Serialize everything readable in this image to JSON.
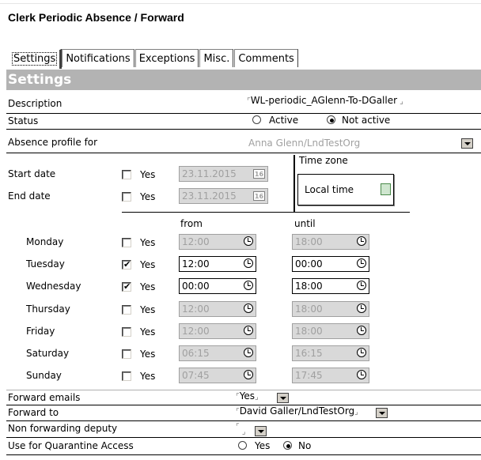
{
  "title": "Clerk Periodic Absence / Forward",
  "tabs": [
    {
      "label": "Settings",
      "active": true
    },
    {
      "label": "Notifications"
    },
    {
      "label": "Exceptions"
    },
    {
      "label": "Misc."
    },
    {
      "label": "Comments"
    }
  ],
  "section_title": "Settings",
  "description": {
    "label": "Description",
    "value": "WL-periodic_AGlenn-To-DGaller"
  },
  "status": {
    "label": "Status",
    "options": [
      "Active",
      "Not active"
    ],
    "selected": "Not active"
  },
  "absence_profile": {
    "label": "Absence profile for",
    "value": "Anna Glenn/LndTestOrg"
  },
  "start_date": {
    "label": "Start date",
    "yes_label": "Yes",
    "checked": false,
    "value": "23.11.2015",
    "cal_icon": "16"
  },
  "end_date": {
    "label": "End date",
    "yes_label": "Yes",
    "checked": false,
    "value": "23.11.2015",
    "cal_icon": "16"
  },
  "time_zone": {
    "label": "Time zone",
    "value": "Local time"
  },
  "schedule": {
    "from_header": "from",
    "until_header": "until",
    "days": [
      {
        "day": "Monday",
        "yes_label": "Yes",
        "checked": false,
        "from": "12:00",
        "until": "18:00"
      },
      {
        "day": "Tuesday",
        "yes_label": "Yes",
        "checked": true,
        "from": "12:00",
        "until": "00:00"
      },
      {
        "day": "Wednesday",
        "yes_label": "Yes",
        "checked": true,
        "from": "00:00",
        "until": "18:00"
      },
      {
        "day": "Thursday",
        "yes_label": "Yes",
        "checked": false,
        "from": "12:00",
        "until": "18:00"
      },
      {
        "day": "Friday",
        "yes_label": "Yes",
        "checked": false,
        "from": "12:00",
        "until": "18:00"
      },
      {
        "day": "Saturday",
        "yes_label": "Yes",
        "checked": false,
        "from": "06:15",
        "until": "16:15"
      },
      {
        "day": "Sunday",
        "yes_label": "Yes",
        "checked": false,
        "from": "07:45",
        "until": "17:45"
      }
    ]
  },
  "forward_emails": {
    "label": "Forward emails",
    "value": "Yes"
  },
  "forward_to": {
    "label": "Forward to",
    "value": "David Galler/LndTestOrg"
  },
  "non_forwarding_deputy": {
    "label": "Non forwarding deputy",
    "value": ""
  },
  "quarantine": {
    "label": "Use for Quarantine Access",
    "options": [
      "Yes",
      "No"
    ],
    "selected": "No"
  }
}
